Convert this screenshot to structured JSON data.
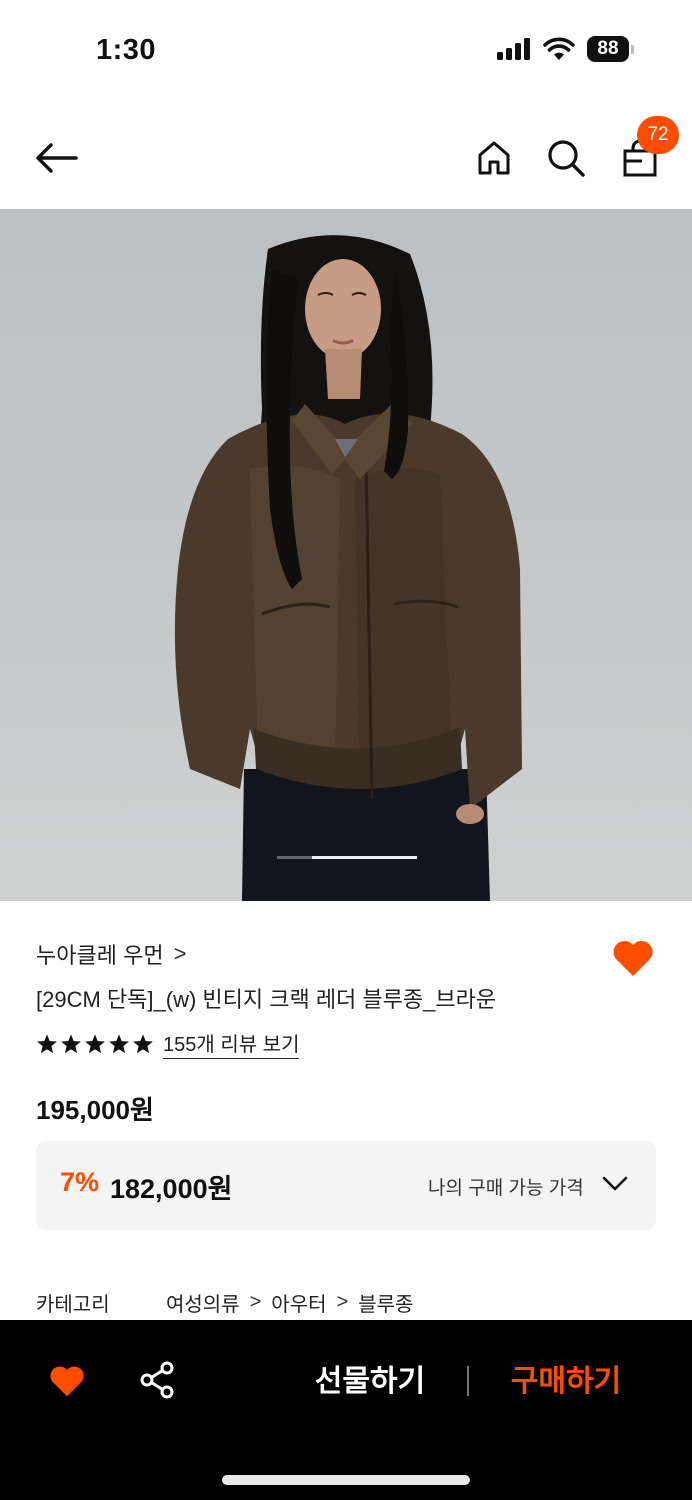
{
  "status_bar": {
    "time": "1:30",
    "battery": "88"
  },
  "nav": {
    "cart_badge": "72"
  },
  "product": {
    "brand": "누아클레 우먼",
    "brand_chevron": ">",
    "title": "[29CM 단독]_(w) 빈티지 크랙 레더 블루종_브라운",
    "rating_stars": 5,
    "review_link": "155개 리뷰 보기",
    "price_original": "195,000원",
    "discount_rate": "7%",
    "discount_price": "182,000원",
    "my_price_label": "나의 구매 가능 가격"
  },
  "category": {
    "label": "카테고리",
    "path": [
      "여성의류",
      "아우터",
      "블루종"
    ],
    "separator": ">"
  },
  "bottom_bar": {
    "gift_label": "선물하기",
    "buy_label": "구매하기"
  },
  "colors": {
    "accent": "#ff4d00",
    "bottom_bar_bg": "#000000",
    "price_box_bg": "#f4f4f4"
  },
  "carousel": {
    "progress": 0.75
  },
  "icons": [
    "back-arrow-icon",
    "home-icon",
    "search-icon",
    "cart-icon",
    "heart-icon",
    "star-icon",
    "chevron-down-icon",
    "share-icon"
  ]
}
